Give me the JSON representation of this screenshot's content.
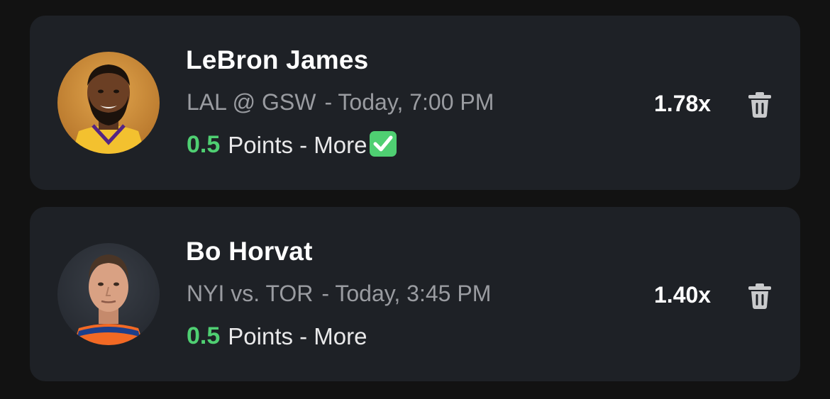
{
  "picks": [
    {
      "player_name": "LeBron James",
      "matchup": "LAL @ GSW",
      "game_time": "- Today, 7:00 PM",
      "line_value": "0.5",
      "line_text": "Points - More",
      "multiplier": "1.78x",
      "status_icon": "check-mark-icon",
      "status_color": "#4fcf72",
      "team_color": "#f3c12f"
    },
    {
      "player_name": "Bo Horvat",
      "matchup": "NYI vs. TOR",
      "game_time": "- Today, 3:45 PM",
      "line_value": "0.5",
      "line_text": "Points - More",
      "multiplier": "1.40x",
      "team_color": "#f26924"
    }
  ],
  "theme": {
    "background": "#121212",
    "card": "#1e2126",
    "accent_green": "#4fcf72",
    "muted_text": "#9a9ca1"
  }
}
